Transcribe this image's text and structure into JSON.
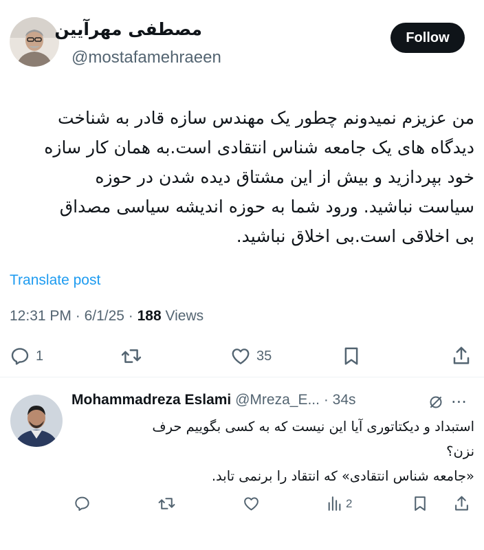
{
  "tweet": {
    "author_name": "مصطفی مهرآیین",
    "author_handle": "@mostafamehraeen",
    "follow_label": "Follow",
    "body_lines": [
      "من عزیزم نمیدونم چطور یک مهندس سازه قادر به شناخت",
      "دیدگاه های یک جامعه شناس انتقادی است.به همان کار سازه",
      "خود بپردازید و بیش از این مشتاق دیده شدن در حوزه",
      "سیاست نباشید. ورود شما به حوزه اندیشه سیاسی مصداق",
      "بی اخلاقی است.بی اخلاق نباشید."
    ],
    "translate_label": "Translate post",
    "time": "12:31 PM",
    "date": "6/1/25",
    "views_count": "188",
    "views_label": "Views",
    "replies_count": "1",
    "likes_count": "35",
    "icons": [
      "reply-icon",
      "retweet-icon",
      "like-icon",
      "bookmark-icon",
      "share-icon"
    ]
  },
  "reply": {
    "author_name": "Mohammadreza Eslami",
    "author_handle": "@Mreza_E...",
    "time": "34s",
    "body_lines": [
      "استبداد و دیکتاتوری آیا این نیست که به کسی بگوییم حرف",
      "نزن؟",
      "«جامعه شناس انتقادی» که انتقاد را برنمی تابد."
    ],
    "views_count": "2",
    "more_symbol": "···",
    "icons": [
      "reply-icon",
      "retweet-icon",
      "like-icon",
      "views-icon",
      "bookmark-icon",
      "share-icon"
    ]
  },
  "colors": {
    "text": "#0f1419",
    "muted": "#536471",
    "link": "#1d9bf0",
    "follow_bg": "#0f1419"
  }
}
